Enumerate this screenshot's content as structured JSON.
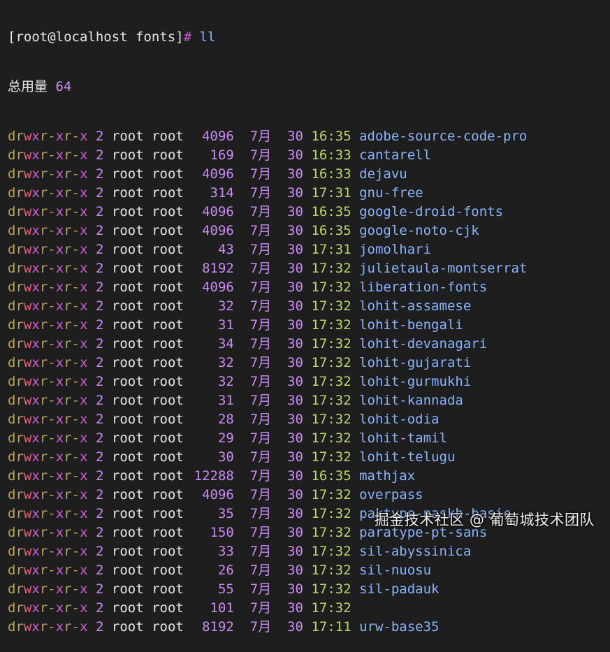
{
  "prompt": {
    "open": "[",
    "user_host_dir": "root@localhost fonts",
    "close": "]",
    "hash": "#",
    "command": "ll"
  },
  "total": {
    "label": "总用量",
    "value": "64"
  },
  "colors": {
    "background": "#1e1e1e",
    "text": "#e6e6e6",
    "perm_read": "#b8a35a",
    "perm_write": "#e6607e",
    "perm_exec": "#d35dd6",
    "number": "#c98cf0",
    "time": "#b9d76c",
    "dirname": "#8ab4ff"
  },
  "entries": [
    {
      "perm": "drwxr-xr-x",
      "links": "2",
      "owner": "root",
      "group": "root",
      "size": "4096",
      "month": "7月",
      "day": "30",
      "time": "16:35",
      "name": "adobe-source-code-pro"
    },
    {
      "perm": "drwxr-xr-x",
      "links": "2",
      "owner": "root",
      "group": "root",
      "size": "169",
      "month": "7月",
      "day": "30",
      "time": "16:33",
      "name": "cantarell"
    },
    {
      "perm": "drwxr-xr-x",
      "links": "2",
      "owner": "root",
      "group": "root",
      "size": "4096",
      "month": "7月",
      "day": "30",
      "time": "16:33",
      "name": "dejavu"
    },
    {
      "perm": "drwxr-xr-x",
      "links": "2",
      "owner": "root",
      "group": "root",
      "size": "314",
      "month": "7月",
      "day": "30",
      "time": "17:31",
      "name": "gnu-free"
    },
    {
      "perm": "drwxr-xr-x",
      "links": "2",
      "owner": "root",
      "group": "root",
      "size": "4096",
      "month": "7月",
      "day": "30",
      "time": "16:35",
      "name": "google-droid-fonts"
    },
    {
      "perm": "drwxr-xr-x",
      "links": "2",
      "owner": "root",
      "group": "root",
      "size": "4096",
      "month": "7月",
      "day": "30",
      "time": "16:35",
      "name": "google-noto-cjk"
    },
    {
      "perm": "drwxr-xr-x",
      "links": "2",
      "owner": "root",
      "group": "root",
      "size": "43",
      "month": "7月",
      "day": "30",
      "time": "17:31",
      "name": "jomolhari"
    },
    {
      "perm": "drwxr-xr-x",
      "links": "2",
      "owner": "root",
      "group": "root",
      "size": "8192",
      "month": "7月",
      "day": "30",
      "time": "17:32",
      "name": "julietaula-montserrat"
    },
    {
      "perm": "drwxr-xr-x",
      "links": "2",
      "owner": "root",
      "group": "root",
      "size": "4096",
      "month": "7月",
      "day": "30",
      "time": "17:32",
      "name": "liberation-fonts"
    },
    {
      "perm": "drwxr-xr-x",
      "links": "2",
      "owner": "root",
      "group": "root",
      "size": "32",
      "month": "7月",
      "day": "30",
      "time": "17:32",
      "name": "lohit-assamese"
    },
    {
      "perm": "drwxr-xr-x",
      "links": "2",
      "owner": "root",
      "group": "root",
      "size": "31",
      "month": "7月",
      "day": "30",
      "time": "17:32",
      "name": "lohit-bengali"
    },
    {
      "perm": "drwxr-xr-x",
      "links": "2",
      "owner": "root",
      "group": "root",
      "size": "34",
      "month": "7月",
      "day": "30",
      "time": "17:32",
      "name": "lohit-devanagari"
    },
    {
      "perm": "drwxr-xr-x",
      "links": "2",
      "owner": "root",
      "group": "root",
      "size": "32",
      "month": "7月",
      "day": "30",
      "time": "17:32",
      "name": "lohit-gujarati"
    },
    {
      "perm": "drwxr-xr-x",
      "links": "2",
      "owner": "root",
      "group": "root",
      "size": "32",
      "month": "7月",
      "day": "30",
      "time": "17:32",
      "name": "lohit-gurmukhi"
    },
    {
      "perm": "drwxr-xr-x",
      "links": "2",
      "owner": "root",
      "group": "root",
      "size": "31",
      "month": "7月",
      "day": "30",
      "time": "17:32",
      "name": "lohit-kannada"
    },
    {
      "perm": "drwxr-xr-x",
      "links": "2",
      "owner": "root",
      "group": "root",
      "size": "28",
      "month": "7月",
      "day": "30",
      "time": "17:32",
      "name": "lohit-odia"
    },
    {
      "perm": "drwxr-xr-x",
      "links": "2",
      "owner": "root",
      "group": "root",
      "size": "29",
      "month": "7月",
      "day": "30",
      "time": "17:32",
      "name": "lohit-tamil"
    },
    {
      "perm": "drwxr-xr-x",
      "links": "2",
      "owner": "root",
      "group": "root",
      "size": "30",
      "month": "7月",
      "day": "30",
      "time": "17:32",
      "name": "lohit-telugu"
    },
    {
      "perm": "drwxr-xr-x",
      "links": "2",
      "owner": "root",
      "group": "root",
      "size": "12288",
      "month": "7月",
      "day": "30",
      "time": "16:35",
      "name": "mathjax"
    },
    {
      "perm": "drwxr-xr-x",
      "links": "2",
      "owner": "root",
      "group": "root",
      "size": "4096",
      "month": "7月",
      "day": "30",
      "time": "17:32",
      "name": "overpass"
    },
    {
      "perm": "drwxr-xr-x",
      "links": "2",
      "owner": "root",
      "group": "root",
      "size": "35",
      "month": "7月",
      "day": "30",
      "time": "17:32",
      "name": "paktype-naskh-basic"
    },
    {
      "perm": "drwxr-xr-x",
      "links": "2",
      "owner": "root",
      "group": "root",
      "size": "150",
      "month": "7月",
      "day": "30",
      "time": "17:32",
      "name": "paratype-pt-sans"
    },
    {
      "perm": "drwxr-xr-x",
      "links": "2",
      "owner": "root",
      "group": "root",
      "size": "33",
      "month": "7月",
      "day": "30",
      "time": "17:32",
      "name": "sil-abyssinica"
    },
    {
      "perm": "drwxr-xr-x",
      "links": "2",
      "owner": "root",
      "group": "root",
      "size": "26",
      "month": "7月",
      "day": "30",
      "time": "17:32",
      "name": "sil-nuosu"
    },
    {
      "perm": "drwxr-xr-x",
      "links": "2",
      "owner": "root",
      "group": "root",
      "size": "55",
      "month": "7月",
      "day": "30",
      "time": "17:32",
      "name": "sil-padauk"
    },
    {
      "perm": "drwxr-xr-x",
      "links": "2",
      "owner": "root",
      "group": "root",
      "size": "101",
      "month": "7月",
      "day": "30",
      "time": "17:32",
      "name": ""
    },
    {
      "perm": "drwxr-xr-x",
      "links": "2",
      "owner": "root",
      "group": "root",
      "size": "8192",
      "month": "7月",
      "day": "30",
      "time": "17:11",
      "name": "urw-base35"
    }
  ],
  "watermark": "掘金技术社区 @ 葡萄城技术团队"
}
